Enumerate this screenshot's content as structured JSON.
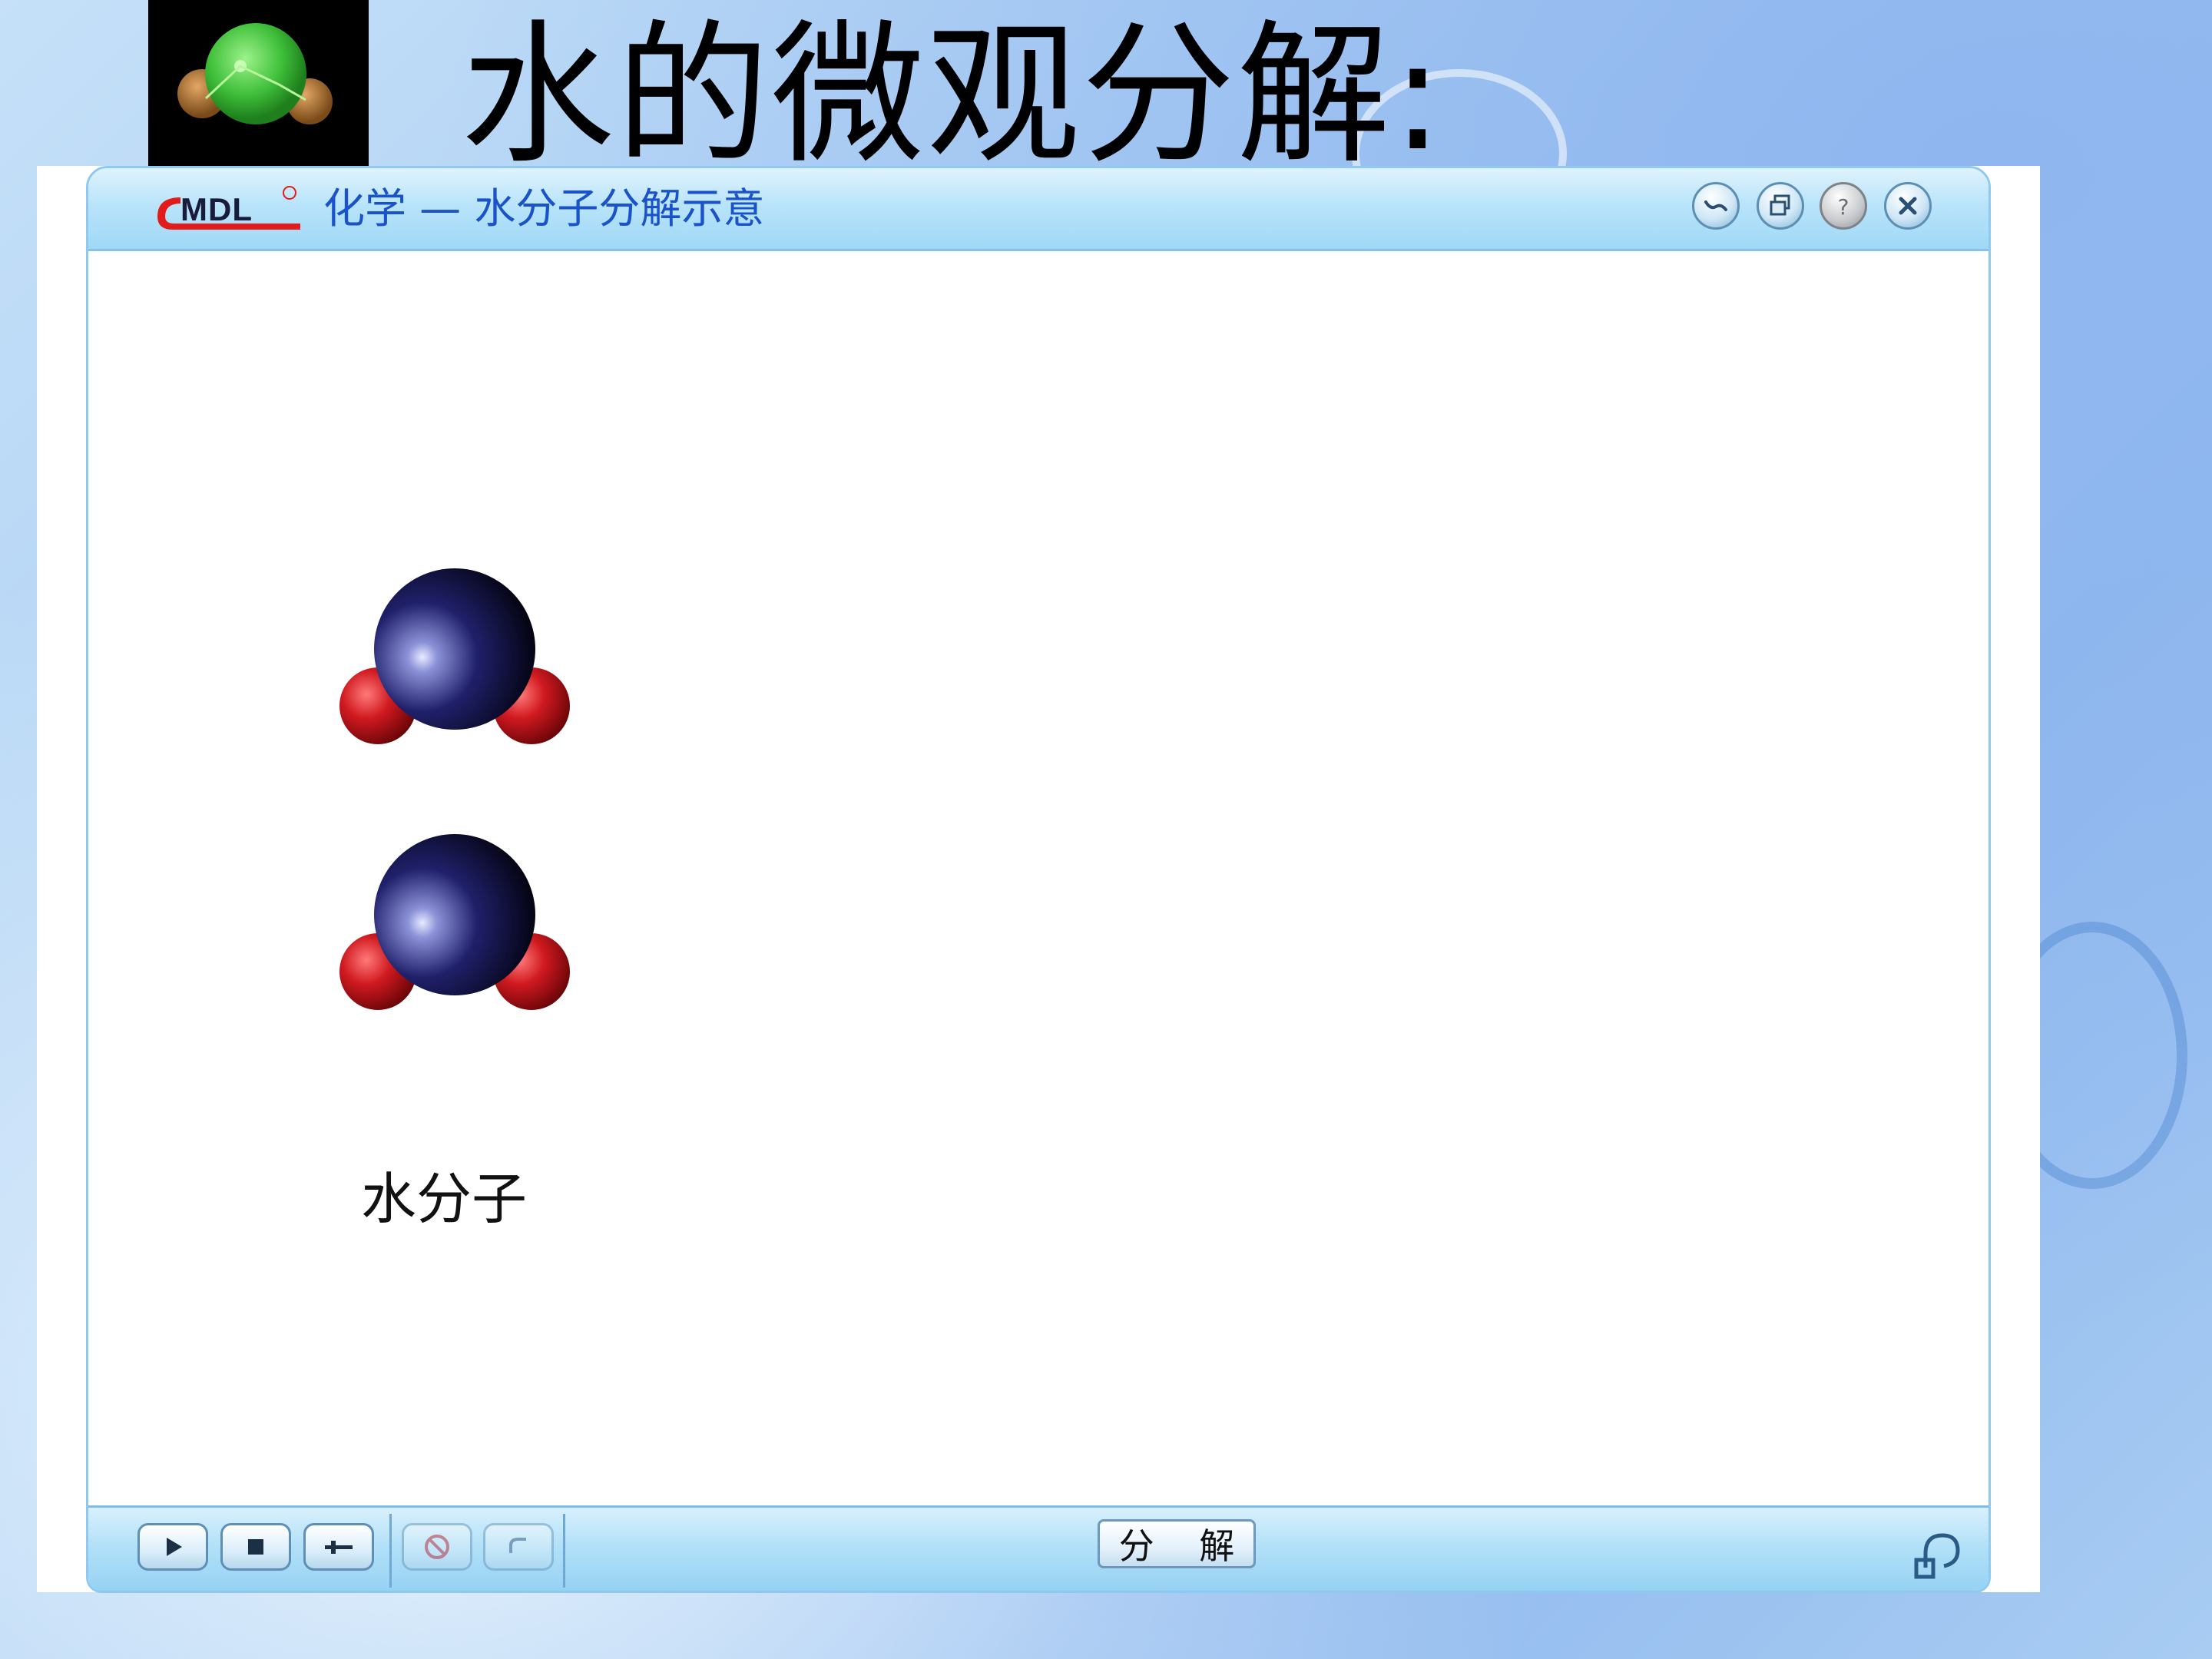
{
  "slide": {
    "title": "水的微观分解:"
  },
  "app": {
    "logo_text": "MDL",
    "window_title": "化学 — 水分子分解示意",
    "window_buttons": [
      "minimize-icon",
      "restore-icon",
      "help-icon",
      "close-icon"
    ]
  },
  "stage": {
    "molecule_label": "水分子",
    "molecule_count": 2
  },
  "controls": {
    "buttons": [
      "play-icon",
      "stop-icon",
      "step-icon",
      "disabled-icon",
      "undo-icon"
    ],
    "action_label": "分 解"
  },
  "colors": {
    "title_blue": "#1a53c9",
    "atom_dark_blue": "#14145a",
    "atom_red": "#c4141c",
    "logo_green": "#3fbf3a"
  }
}
